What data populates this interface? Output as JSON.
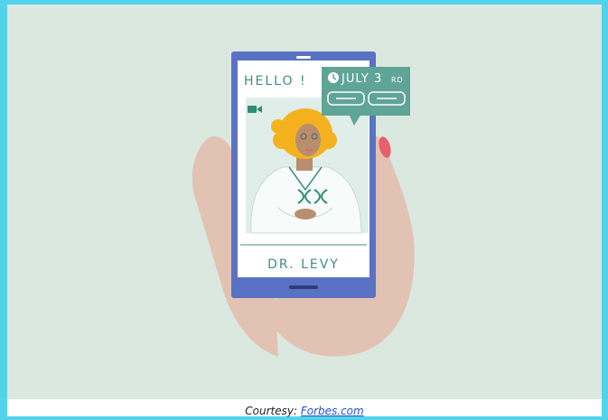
{
  "illustration": {
    "greeting": "HELLO !",
    "date_text": "JULY 3",
    "date_suffix": "RD",
    "doctor_name": "DR. LEVY",
    "icons": [
      "video-camera-icon",
      "clock-icon",
      "dna-logo-icon"
    ],
    "colors": {
      "background": "#dbe8e0",
      "phone": "#5a72c4",
      "bubble": "#5fa597",
      "hand": "#e2c2b3",
      "hair": "#f5b21f",
      "accent_text": "#3f8d83",
      "nail": "#e8606a"
    }
  },
  "caption": {
    "prefix": "Courtesy: ",
    "link_text": "Forbes.com"
  }
}
